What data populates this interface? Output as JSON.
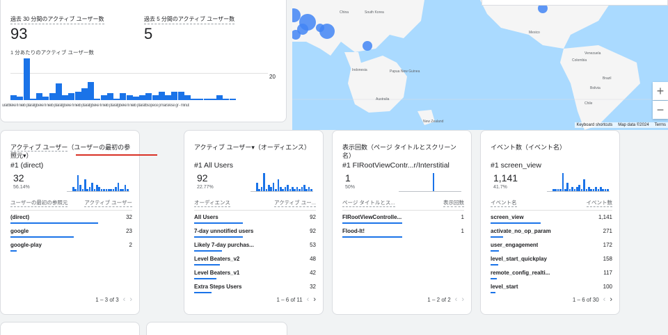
{
  "realtime": {
    "label_30": "過去 30 分間のアクティブ ユーザー数",
    "value_30": "93",
    "label_5": "過去 5 分間のアクティブ ユーザー数",
    "value_5": "5",
    "chart_title": "1 分あたりのアクティブ ユーザー数",
    "axis_label": "20",
    "x_labels": "urarbteke fi nieib ptarafgbeke fi nieib ptarafgbeke fi nieib ptarafgbeke fi nieib ptarafgbeke fi nieib ptarafbsopece pmarsrese gr - minut",
    "chart_data": {
      "type": "bar",
      "ylabel_tick": 20,
      "values": [
        3,
        2,
        25,
        1,
        4,
        2,
        4,
        10,
        3,
        4,
        5,
        7,
        11,
        1,
        3,
        4,
        1,
        4,
        3,
        2,
        3,
        4,
        3,
        5,
        3,
        5,
        5,
        3,
        1,
        1,
        1,
        1,
        3,
        1,
        1,
        0,
        0,
        0,
        0,
        0
      ]
    }
  },
  "map": {
    "labels": [
      "China",
      "South Korea",
      "Indonesia",
      "Papua New Guinea",
      "Australia",
      "New Zealand",
      "Mexico",
      "Venezuela",
      "Colombia",
      "Brazil",
      "Bolivia",
      "Chile"
    ],
    "footer": [
      "Keyboard shortcuts",
      "Map data ©2024",
      "Terms"
    ],
    "zoom_in": "+",
    "zoom_out": "−"
  },
  "cards": [
    {
      "title_prefix": "アクティブ ユーザー",
      "title_suffix": "（ユーザーの最初の参照元",
      "top_rank": "#1  (direct)",
      "top_value": "32",
      "top_pct": "56.14%",
      "col_left": "ユーザーの最初の参照元",
      "col_right": "アクティブ ユーザー",
      "rows": [
        {
          "label": "(direct)",
          "value": "32",
          "frac": 0.72
        },
        {
          "label": "google",
          "value": "23",
          "frac": 0.52
        },
        {
          "label": "google-play",
          "value": "2",
          "frac": 0.05
        }
      ],
      "pager": "1 – 3 of 3"
    },
    {
      "title": "アクティブ ユーザー▾（オーディエンス）",
      "top_rank": "#1  All Users",
      "top_value": "92",
      "top_pct": "22.77%",
      "col_left": "オーディエンス",
      "col_right": "アクティブ ユー...",
      "rows": [
        {
          "label": "All Users",
          "value": "92",
          "frac": 0.4
        },
        {
          "label": "7-day unnotified users",
          "value": "92",
          "frac": 0.4
        },
        {
          "label": "Likely 7-day purchas...",
          "value": "53",
          "frac": 0.23
        },
        {
          "label": "Level Beaters_v2",
          "value": "48",
          "frac": 0.21
        },
        {
          "label": "Level Beaters_v1",
          "value": "42",
          "frac": 0.18
        },
        {
          "label": "Extra Steps Users",
          "value": "32",
          "frac": 0.14
        }
      ],
      "pager": "1 – 6 of 11"
    },
    {
      "title": "表示回数（ページ タイトルとスクリーン名）",
      "top_rank": "#1  FIRootViewContr...r/Interstitial",
      "top_value": "1",
      "top_pct": "50%",
      "col_left": "ページ タイトルとス...",
      "col_right": "表示回数",
      "rows": [
        {
          "label": "FIRootViewControlle...",
          "value": "1",
          "frac": 0.49
        },
        {
          "label": "Flood-It!",
          "value": "1",
          "frac": 0.49
        }
      ],
      "pager": "1 – 2 of 2"
    },
    {
      "title": "イベント数（イベント名）",
      "top_rank": "#1  screen_view",
      "top_value": "1,141",
      "top_pct": "41.7%",
      "col_left": "イベント名",
      "col_right": "イベント数",
      "rows": [
        {
          "label": "screen_view",
          "value": "1,141",
          "frac": 0.41
        },
        {
          "label": "activate_no_op_param",
          "value": "271",
          "frac": 0.1
        },
        {
          "label": "user_engagement",
          "value": "172",
          "frac": 0.07
        },
        {
          "label": "level_start_quickplay",
          "value": "158",
          "frac": 0.06
        },
        {
          "label": "remote_config_realti...",
          "value": "117",
          "frac": 0.05
        },
        {
          "label": "level_start",
          "value": "100",
          "frac": 0.04
        }
      ],
      "pager": "1 – 6 of 30"
    }
  ],
  "colors": {
    "accent": "#1a73e8",
    "highlight": "#d93025",
    "map_water": "#aadaff",
    "map_land": "#f5f5f5"
  }
}
